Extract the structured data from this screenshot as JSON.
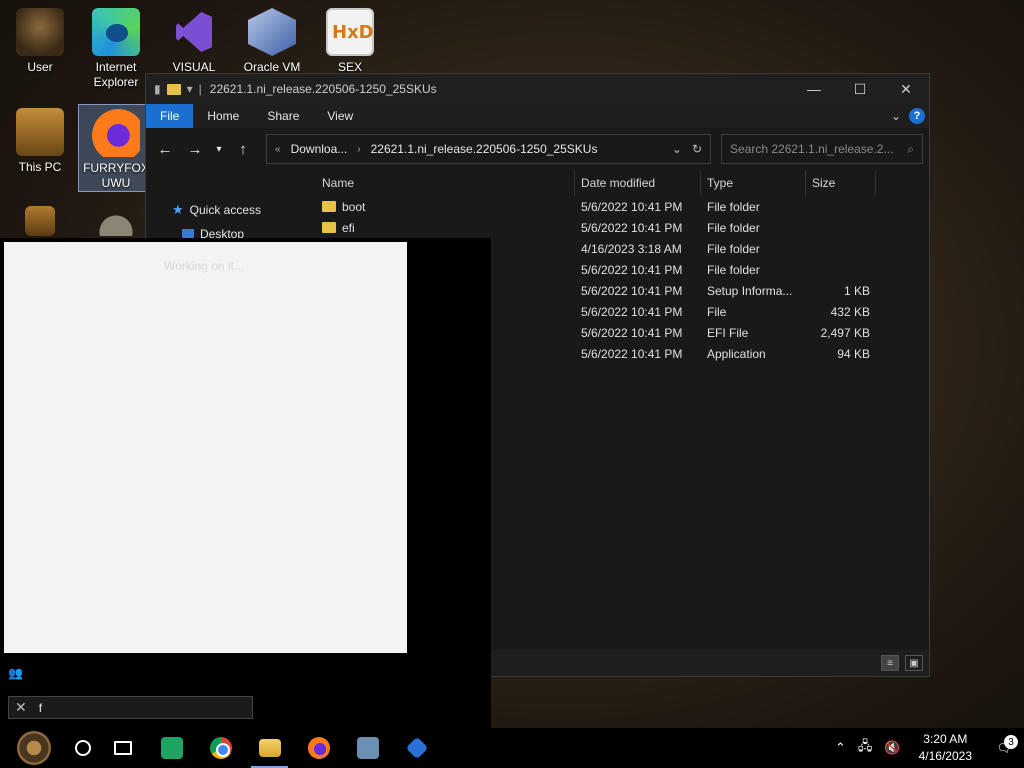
{
  "desktop": {
    "icons": [
      {
        "label": "User"
      },
      {
        "label": "Internet Explorer"
      },
      {
        "label": "VISUAL"
      },
      {
        "label": "Oracle VM"
      },
      {
        "label": "SEX"
      },
      {
        "label": "This PC"
      },
      {
        "label": "FURRYFOX UWU"
      }
    ]
  },
  "explorer": {
    "title": "22621.1.ni_release.220506-1250_25SKUs",
    "ribbon": {
      "tabs": [
        "File",
        "Home",
        "Share",
        "View"
      ],
      "help": "?"
    },
    "address": {
      "parts": [
        "Downloa...",
        "22621.1.ni_release.220506-1250_25SKUs"
      ]
    },
    "search_placeholder": "Search 22621.1.ni_release.2...",
    "nav": {
      "quick_access": "Quick access",
      "desktop": "Desktop"
    },
    "columns": {
      "name": "Name",
      "date": "Date modified",
      "type": "Type",
      "size": "Size"
    },
    "rows": [
      {
        "name": "boot",
        "date": "5/6/2022 10:41 PM",
        "type": "File folder",
        "size": ""
      },
      {
        "name": "efi",
        "date": "5/6/2022 10:41 PM",
        "type": "File folder",
        "size": ""
      },
      {
        "name": "",
        "date": "4/16/2023 3:18 AM",
        "type": "File folder",
        "size": ""
      },
      {
        "name": "",
        "date": "5/6/2022 10:41 PM",
        "type": "File folder",
        "size": ""
      },
      {
        "name": "",
        "date": "5/6/2022 10:41 PM",
        "type": "Setup Informa...",
        "size": "1 KB"
      },
      {
        "name": "",
        "date": "5/6/2022 10:41 PM",
        "type": "File",
        "size": "432 KB"
      },
      {
        "name": "",
        "date": "5/6/2022 10:41 PM",
        "type": "EFI File",
        "size": "2,497 KB"
      },
      {
        "name": "",
        "date": "5/6/2022 10:41 PM",
        "type": "Application",
        "size": "94 KB"
      }
    ]
  },
  "overlay": {
    "working_text": "Working on it..."
  },
  "search_box": {
    "value": "f"
  },
  "taskbar": {
    "clock_time": "3:20 AM",
    "clock_date": "4/16/2023",
    "notification_count": "3"
  }
}
